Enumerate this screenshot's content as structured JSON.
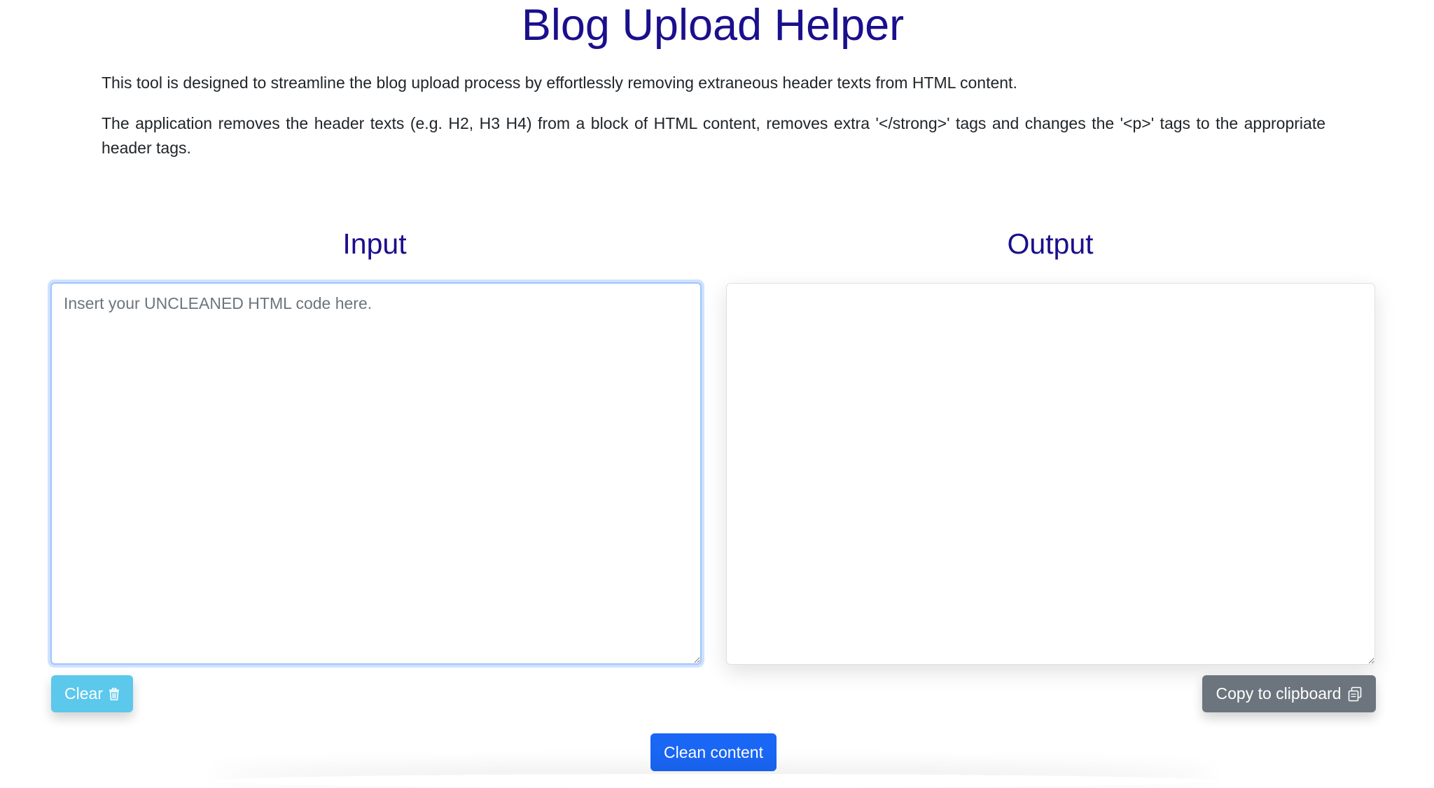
{
  "header": {
    "title": "Blog Upload Helper"
  },
  "intro": {
    "paragraph_1": "This tool is designed to streamline the blog upload process by effortlessly removing extraneous header texts from HTML content.",
    "paragraph_2": "The application removes the header texts (e.g. H2, H3 H4) from a block of HTML content, removes extra '</strong>' tags and changes the '<p>' tags to the appropriate header tags."
  },
  "input_panel": {
    "heading": "Input",
    "placeholder": "Insert your UNCLEANED HTML code here.",
    "value": ""
  },
  "output_panel": {
    "heading": "Output",
    "value": ""
  },
  "buttons": {
    "clear_label": "Clear",
    "clear_icon": "trash-icon",
    "copy_label": "Copy to clipboard",
    "copy_icon": "clipboard-icon",
    "clean_label": "Clean content"
  },
  "colors": {
    "heading": "#1a0f8c",
    "clear_button": "#5bc8ec",
    "copy_button": "#6c757d",
    "clean_button": "#1a66f5",
    "input_focus_border": "#9ec5fe"
  }
}
